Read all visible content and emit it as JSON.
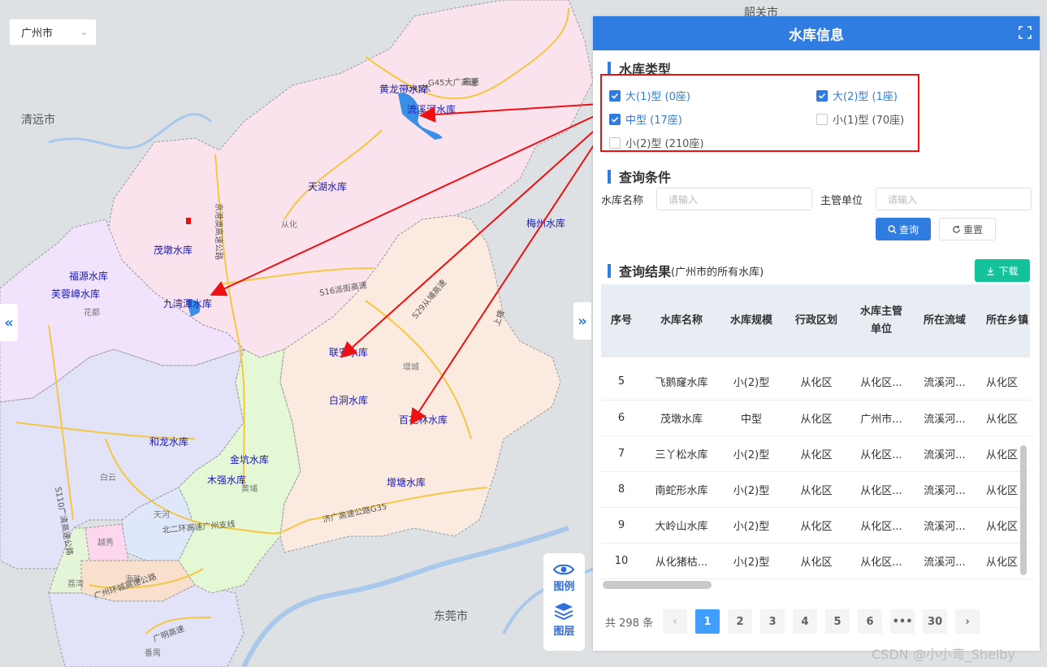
{
  "map": {
    "city_select": "广州市",
    "neighbor_labels": [
      {
        "id": "qingyuan",
        "text": "清远市"
      },
      {
        "id": "shaoguan",
        "text": "韶关市"
      },
      {
        "id": "dongguan",
        "text": "东莞市"
      }
    ],
    "district_labels": [
      "从化",
      "增城",
      "花都",
      "白云",
      "天河",
      "越秀",
      "荔湾",
      "海珠",
      "番禺",
      "黄埔"
    ],
    "road_labels": [
      "京港澳高速公路",
      "S16派街高速",
      "S29从埔高速",
      "济广高速公路G35",
      "北二环高速广州支线",
      "广州环城高速公路",
      "S110广清高速公路",
      "广明高速",
      "G45大广高速",
      "上塘",
      "G45大",
      "高速"
    ],
    "reservoirs": [
      "黄龙带水库",
      "流溪河水库",
      "天湖水库",
      "梅州水库",
      "茂墩水库",
      "福源水库",
      "芙蓉嶂水库",
      "九湾潭水库",
      "联安水库",
      "白洞水库",
      "百花林水库",
      "和龙水库",
      "金坑水库",
      "木强水库",
      "增塘水库"
    ],
    "tools": [
      {
        "id": "legend",
        "label": "图例",
        "icon": "eye-icon"
      },
      {
        "id": "layers",
        "label": "图层",
        "icon": "layers-icon"
      }
    ]
  },
  "panel": {
    "title": "水库信息",
    "type_section_title": "水库类型",
    "types": [
      {
        "label": "大(1)型 (0座)",
        "checked": true
      },
      {
        "label": "大(2)型 (1座)",
        "checked": true
      },
      {
        "label": "中型 (17座)",
        "checked": true
      },
      {
        "label": "小(1)型 (70座)",
        "checked": false
      },
      {
        "label": "小(2)型 (210座)",
        "checked": false
      }
    ],
    "query_section_title": "查询条件",
    "name_label": "水库名称",
    "name_placeholder": "请输入",
    "unit_label": "主管单位",
    "unit_placeholder": "请输入",
    "search_button": "查询",
    "reset_button": "重置",
    "result_title": "查询结果",
    "result_subtitle": "(广州市的所有水库)",
    "download_button": "下载",
    "columns": [
      "序号",
      "水库名称",
      "水库规模",
      "行政区划",
      "水库主管单位",
      "所在流域",
      "所在乡镇"
    ],
    "rows": [
      [
        "5",
        "飞鹅窿水库",
        "小(2)型",
        "从化区",
        "从化区...",
        "流溪河...",
        "从化区"
      ],
      [
        "6",
        "茂墩水库",
        "中型",
        "从化区",
        "广州市...",
        "流溪河...",
        "从化区"
      ],
      [
        "7",
        "三丫松水库",
        "小(2)型",
        "从化区",
        "从化区...",
        "流溪河...",
        "从化区"
      ],
      [
        "8",
        "南蛇形水库",
        "小(2)型",
        "从化区",
        "从化区...",
        "流溪河...",
        "从化区"
      ],
      [
        "9",
        "大岭山水库",
        "小(2)型",
        "从化区",
        "从化区...",
        "流溪河...",
        "从化区"
      ],
      [
        "10",
        "从化猪枯...",
        "小(2)型",
        "从化区",
        "从化区...",
        "流溪河...",
        "从化区"
      ]
    ],
    "pagination": {
      "total_text": "共 298 条",
      "pages": [
        "1",
        "2",
        "3",
        "4",
        "5",
        "6",
        "•••",
        "30"
      ],
      "current": "1"
    }
  },
  "watermark": "CSDN @小小弯_Shelby",
  "colors": {
    "accent": "#2f7de1",
    "download": "#13c29a",
    "highlight": "#ee1111",
    "region_conghua": "#fbe3ee",
    "region_huadu": "#f0e3fb",
    "region_baiyun": "#e2e2f9",
    "region_huangpu": "#e5f8d5",
    "region_zengcheng": "#fbeae0"
  }
}
